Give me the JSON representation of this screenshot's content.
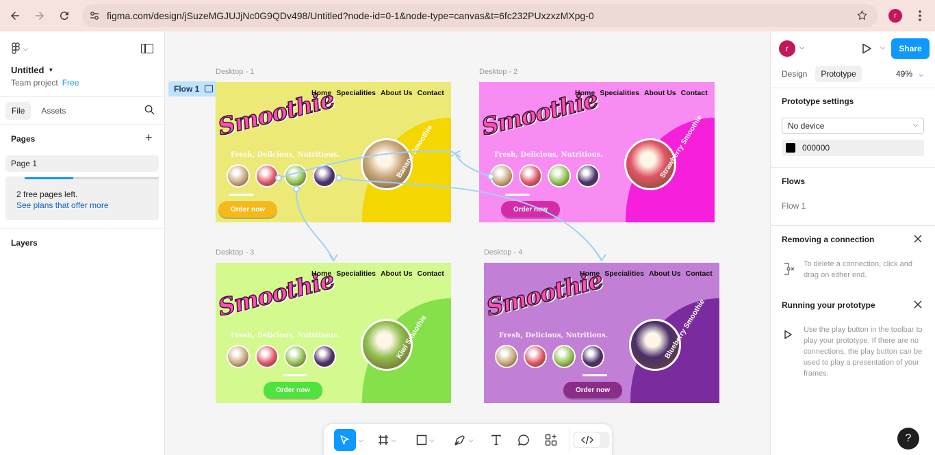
{
  "browser": {
    "url": "figma.com/design/jSuzeMGJUJjNc0G9QDv498/Untitled?node-id=0-1&node-type=canvas&t=6fc232PUxzxzMXpg-0",
    "profile_initial": "r"
  },
  "left_panel": {
    "file_name": "Untitled",
    "project": "Team project",
    "plan": "Free",
    "tabs": [
      "File",
      "Assets"
    ],
    "pages_heading": "Pages",
    "pages": [
      "Page 1"
    ],
    "free_pages_text": "2 free pages left.",
    "free_pages_link": "See plans that offer more",
    "free_pages_used": 0.36,
    "layers_heading": "Layers"
  },
  "canvas": {
    "flow_chip": "Flow 1",
    "frames": [
      {
        "label": "Desktop - 1",
        "brand": "Smoothie",
        "nav": [
          "Home",
          "Specialities",
          "About Us",
          "Contact"
        ],
        "tagline": "Fresh, Delicious, Nutritious.",
        "cta": "Order now",
        "vertical": "Banana Smoothie",
        "bg": "#ece977",
        "accent": "#f4d600",
        "button": "#f5b91b"
      },
      {
        "label": "Desktop - 2",
        "brand": "Smoothie",
        "nav": [
          "Home",
          "Specialities",
          "About Us",
          "Contact"
        ],
        "tagline": "Fresh, Delicious, Nutritious.",
        "cta": "Order now",
        "vertical": "Strawberry Smoothie",
        "bg": "#f88cf2",
        "accent": "#f51fdc",
        "button": "#d62ba9"
      },
      {
        "label": "Desktop - 3",
        "brand": "Smoothie",
        "nav": [
          "Home",
          "Specialities",
          "About Us",
          "Contact"
        ],
        "tagline": "Fresh, Delicious, Nutritious.",
        "cta": "Order now",
        "vertical": "Kiwi Smoothie",
        "bg": "#d3f98f",
        "accent": "#86e04a",
        "button": "#4fe33d"
      },
      {
        "label": "Desktop - 4",
        "brand": "Smoothie",
        "nav": [
          "Home",
          "Specialities",
          "About Us",
          "Contact"
        ],
        "tagline": "Fresh, Delicious, Nutritious.",
        "cta": "Order now",
        "vertical": "Blueberry Smoothie",
        "bg": "#c27fd6",
        "accent": "#7a2c9e",
        "button": "#8b2c8a"
      }
    ]
  },
  "toolbar": {
    "tools": [
      "move-tool-icon",
      "frame-tool-icon",
      "rectangle-tool-icon",
      "pen-tool-icon",
      "text-tool-icon",
      "comment-tool-icon",
      "actions-icon",
      "dev-mode-icon"
    ]
  },
  "right_panel": {
    "share_label": "Share",
    "tabs": [
      "Design",
      "Prototype"
    ],
    "zoom": "49%",
    "prototype_settings_heading": "Prototype settings",
    "device": "No device",
    "background_color": "000000",
    "flows_heading": "Flows",
    "flow_name": "Flow 1",
    "removing_heading": "Removing a connection",
    "removing_hint": "To delete a connection, click and drag on either end.",
    "running_heading": "Running your prototype",
    "running_hint": "Use the play button in the toolbar to play your prototype. If there are no connections, the play button can be used to play a presentation of your frames.",
    "help_label": "?"
  }
}
